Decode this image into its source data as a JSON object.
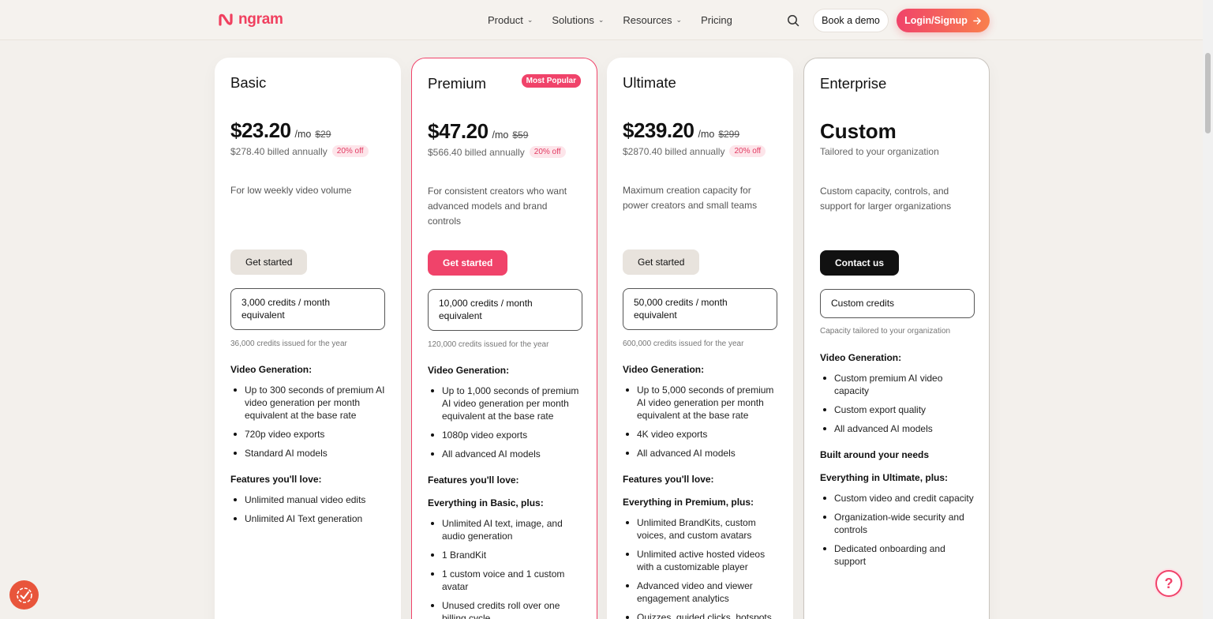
{
  "brand": {
    "name": "ngram",
    "color": "#f0405f"
  },
  "nav": [
    {
      "label": "Product",
      "has_dropdown": true
    },
    {
      "label": "Solutions",
      "has_dropdown": true
    },
    {
      "label": "Resources",
      "has_dropdown": true
    },
    {
      "label": "Pricing",
      "has_dropdown": false
    }
  ],
  "header": {
    "search_icon": "search-icon",
    "demo_label": "Book a demo",
    "login_label": "Login/Signup",
    "login_icon": "arrow-right-icon"
  },
  "plans": [
    {
      "name": "Basic",
      "price": "$23.20",
      "per": "/mo",
      "original": "$29",
      "billed": "$278.40 billed annually",
      "discount": "20% off",
      "description": "For low weekly video volume",
      "cta": "Get started",
      "credits": "3,000 credits / month equivalent",
      "issued": "36,000 credits issued for the year",
      "video_heading": "Video Generation:",
      "video_features": [
        "Up to 300 seconds of premium AI video generation per month equivalent at the base rate",
        "720p video exports",
        "Standard AI models"
      ],
      "features_heading": "Features you'll love:",
      "features": [
        "Unlimited manual video edits",
        "Unlimited AI Text generation"
      ]
    },
    {
      "name": "Premium",
      "badge": "Most Popular",
      "price": "$47.20",
      "per": "/mo",
      "original": "$59",
      "billed": "$566.40 billed annually",
      "discount": "20% off",
      "description": "For consistent creators who want advanced models and brand controls",
      "cta": "Get started",
      "credits": "10,000 credits / month equivalent",
      "issued": "120,000 credits issued for the year",
      "video_heading": "Video Generation:",
      "video_features": [
        "Up to 1,000 seconds of premium AI video generation per month equivalent at the base rate",
        "1080p video exports",
        "All advanced AI models"
      ],
      "features_heading": "Features you'll love:",
      "everything_heading": "Everything in Basic, plus:",
      "features": [
        "Unlimited AI text, image, and audio generation",
        "1 BrandKit",
        "1 custom voice and 1 custom avatar",
        "Unused credits roll over one billing cycle"
      ]
    },
    {
      "name": "Ultimate",
      "price": "$239.20",
      "per": "/mo",
      "original": "$299",
      "billed": "$2870.40 billed annually",
      "discount": "20% off",
      "description": "Maximum creation capacity for power creators and small teams",
      "cta": "Get started",
      "credits": "50,000 credits / month equivalent",
      "issued": "600,000 credits issued for the year",
      "video_heading": "Video Generation:",
      "video_features": [
        "Up to 5,000 seconds of premium AI video generation per month equivalent at the base rate",
        "4K video exports",
        "All advanced AI models"
      ],
      "features_heading": "Features you'll love:",
      "everything_heading": "Everything in Premium, plus:",
      "features": [
        "Unlimited BrandKits, custom voices, and custom avatars",
        "Unlimited active hosted videos with a customizable player",
        "Advanced video and viewer engagement analytics",
        "Quizzes, guided clicks, hotspots"
      ]
    },
    {
      "name": "Enterprise",
      "price": "Custom",
      "subtitle": "Tailored to your organization",
      "description": "Custom capacity, controls, and support for larger organizations",
      "cta": "Contact us",
      "credits": "Custom credits",
      "issued": "Capacity tailored to your organization",
      "video_heading": "Video Generation:",
      "video_features": [
        "Custom premium AI video capacity",
        "Custom export quality",
        "All advanced AI models"
      ],
      "built_heading": "Built around your needs",
      "everything_heading": "Everything in Ultimate, plus:",
      "features": [
        "Custom video and credit capacity",
        "Organization-wide security and controls",
        "Dedicated onboarding and support"
      ]
    }
  ],
  "floating": {
    "cookie_icon": "cookie-check-icon",
    "help_icon": "help-question-icon",
    "help_glyph": "?"
  },
  "colors": {
    "accent": "#f0436a",
    "accent_gradient_end": "#f9804d",
    "background": "#f3f0ec"
  }
}
